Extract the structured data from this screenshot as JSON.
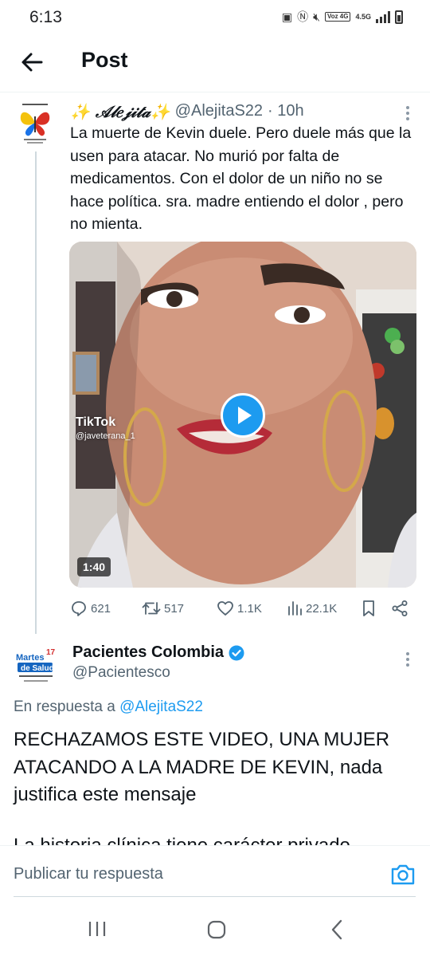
{
  "status_bar": {
    "time": "6:13",
    "net_label": "Voz 4G",
    "speed_label": "4.5G"
  },
  "header": {
    "title": "Post"
  },
  "tweet": {
    "display_name": "✨ 𝒜𝓁𝑒𝒿𝒾𝓉𝒶✨",
    "handle": "@AlejitaS22",
    "time": "· 10h",
    "text": "La muerte de Kevin duele. Pero duele más que la usen para atacar. No murió por falta de medicamentos. Con el dolor de un niño no se hace política. sra. madre entiendo el dolor , pero no mienta.",
    "video": {
      "watermark": "TikTok",
      "watermark_user": "@javeterana_1",
      "duration": "1:40"
    },
    "stats": {
      "replies": "621",
      "reposts": "517",
      "likes": "1.1K",
      "views": "22.1K"
    }
  },
  "reply": {
    "display_name": "Pacientes Colombia",
    "handle": "@Pacientesco",
    "reply_prefix": "En respuesta a",
    "reply_mention": "@AlejitaS22",
    "text": "RECHAZAMOS ESTE VIDEO, UNA MUJER ATACANDO A LA MADRE DE KEVIN, nada justifica este mensaje",
    "text_cut": "La historia clínica tiene carácter privado",
    "avatar_text": {
      "top": "Martes",
      "badge": "17",
      "middle": "de Salud"
    }
  },
  "composer": {
    "placeholder": "Publicar tu respuesta"
  },
  "colors": {
    "accent": "#1d9bf0",
    "text_primary": "#0f1419",
    "text_secondary": "#536471"
  }
}
